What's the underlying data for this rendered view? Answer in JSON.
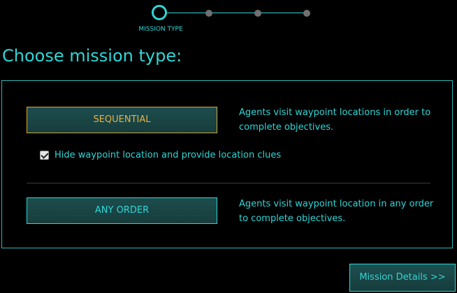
{
  "stepper": {
    "active_label": "MISSION TYPE",
    "steps_total": 4,
    "active_index": 0
  },
  "page_title": "Choose mission type:",
  "options": [
    {
      "label": "SEQUENTIAL",
      "description": "Agents visit waypoint locations in order to complete objectives.",
      "selected": true
    },
    {
      "label": "ANY ORDER",
      "description": "Agents visit waypoint location in any order to complete objectives.",
      "selected": false
    }
  ],
  "hide_waypoint": {
    "label": "Hide waypoint location and provide location clues",
    "checked": true
  },
  "next_button": "Mission Details >>",
  "colors": {
    "accent": "#2fd6d6",
    "selected": "#e4b248",
    "background": "#000000"
  }
}
